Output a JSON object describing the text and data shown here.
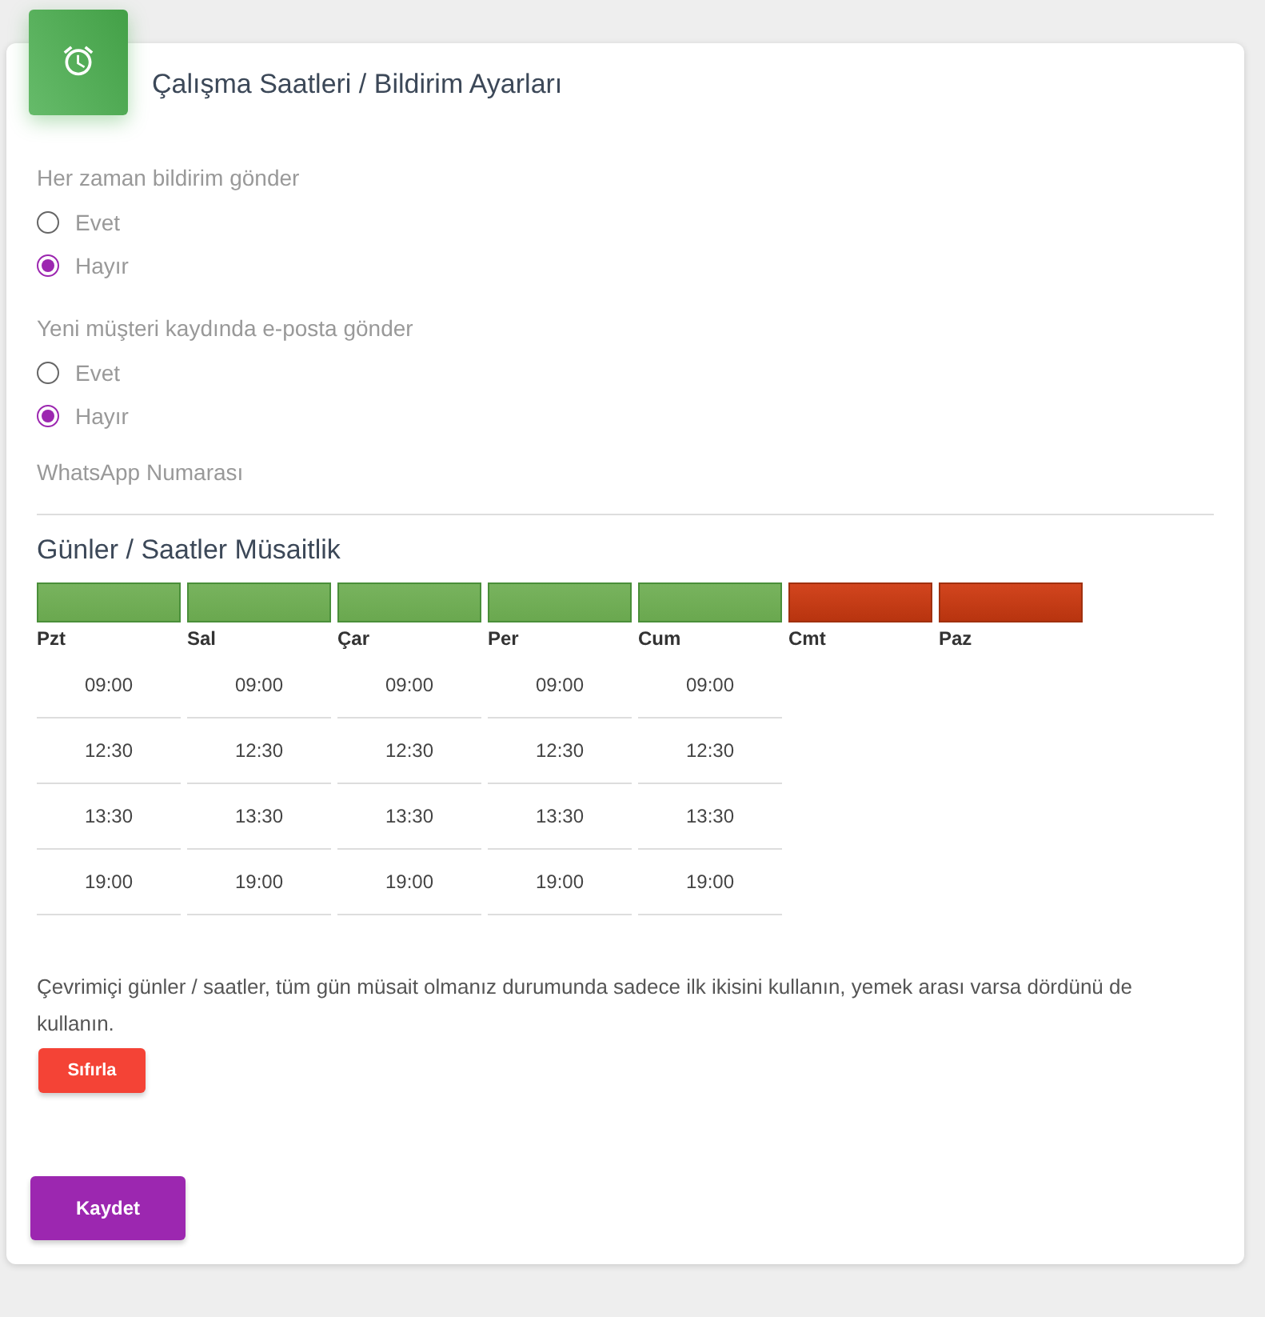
{
  "card": {
    "title": "Çalışma Saatleri / Bildirim Ayarları"
  },
  "settings": [
    {
      "label": "Her zaman bildirim gönder",
      "options": [
        {
          "label": "Evet",
          "selected": false
        },
        {
          "label": "Hayır",
          "selected": true
        }
      ]
    },
    {
      "label": "Yeni müşteri kaydında e-posta gönder",
      "options": [
        {
          "label": "Evet",
          "selected": false
        },
        {
          "label": "Hayır",
          "selected": true
        }
      ]
    }
  ],
  "whatsapp_label": "WhatsApp Numarası",
  "availability": {
    "title": "Günler / Saatler Müsaitlik",
    "days": [
      {
        "label": "Pzt",
        "available": true,
        "times": [
          "09:00",
          "12:30",
          "13:30",
          "19:00"
        ]
      },
      {
        "label": "Sal",
        "available": true,
        "times": [
          "09:00",
          "12:30",
          "13:30",
          "19:00"
        ]
      },
      {
        "label": "Çar",
        "available": true,
        "times": [
          "09:00",
          "12:30",
          "13:30",
          "19:00"
        ]
      },
      {
        "label": "Per",
        "available": true,
        "times": [
          "09:00",
          "12:30",
          "13:30",
          "19:00"
        ]
      },
      {
        "label": "Cum",
        "available": true,
        "times": [
          "09:00",
          "12:30",
          "13:30",
          "19:00"
        ]
      },
      {
        "label": "Cmt",
        "available": false
      },
      {
        "label": "Paz",
        "available": false
      }
    ],
    "note": "Çevrimiçi günler / saatler, tüm gün müsait olmanız durumunda sadece ilk ikisini kullanın, yemek arası varsa dördünü de kullanın.",
    "reset_button": "Sıfırla"
  },
  "save_button": "Kaydet"
}
